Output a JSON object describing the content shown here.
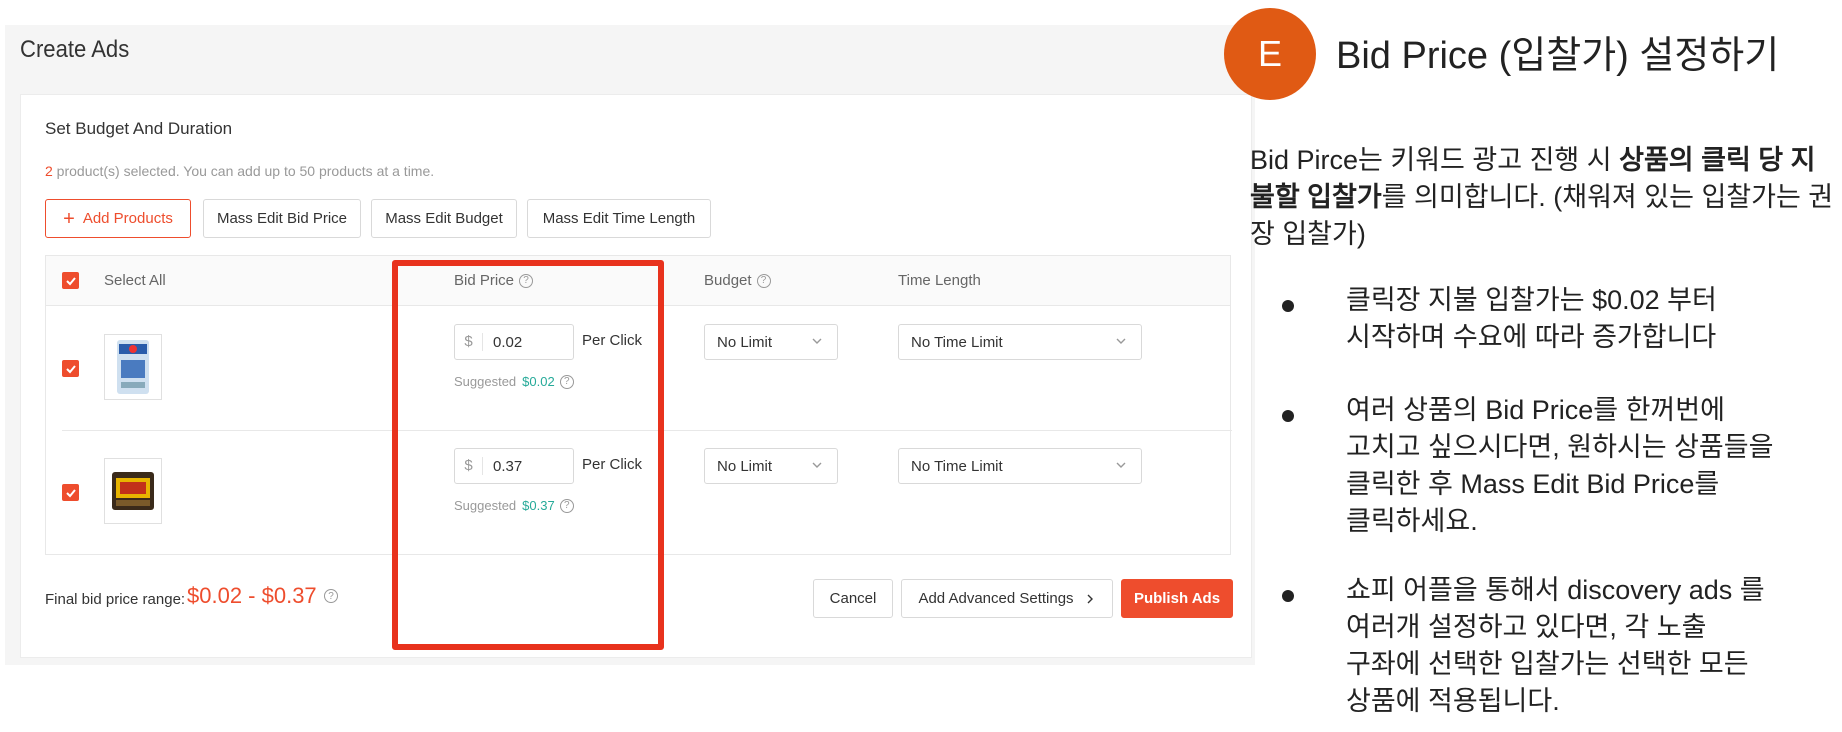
{
  "header": {
    "title": "Create Ads"
  },
  "card": {
    "title": "Set Budget And Duration",
    "selected_count": "2",
    "selected_text": " product(s) selected. You can add up to 50 products at a time."
  },
  "toolbar": {
    "add_products": "Add Products",
    "mass_edit_bid": "Mass Edit Bid Price",
    "mass_edit_budget": "Mass Edit Budget",
    "mass_edit_time": "Mass Edit Time Length"
  },
  "table": {
    "headers": {
      "select_all": "Select All",
      "bid_price": "Bid Price",
      "budget": "Budget",
      "time_length": "Time Length"
    },
    "rows": [
      {
        "currency": "$",
        "bid": "0.02",
        "per_click": "Per Click",
        "suggested_label": "Suggested",
        "suggested_value": "$0.02",
        "budget": "No Limit",
        "time": "No Time Limit"
      },
      {
        "currency": "$",
        "bid": "0.37",
        "per_click": "Per Click",
        "suggested_label": "Suggested",
        "suggested_value": "$0.37",
        "budget": "No Limit",
        "time": "No Time Limit"
      }
    ]
  },
  "footer": {
    "range_label": "Final bid price range:",
    "range_value": "$0.02 - $0.37",
    "cancel": "Cancel",
    "advanced": "Add Advanced Settings",
    "publish": "Publish Ads"
  },
  "explain": {
    "badge": "E",
    "title": "Bid Price (입찰가) 설정하기",
    "intro_1": "Bid Pirce는 키워드 광고 진행 시 ",
    "intro_bold": "상품의 클릭 당 지불할 입찰가",
    "intro_2": "를 의미합니다. (채워져 있는 입찰가는 권장 입찰가)",
    "bullet_1_l1": "클릭장 지불 입찰가는 $0.02 부터",
    "bullet_1_l2": "시작하며 수요에 따라 증가합니다",
    "bullet_2_l1": "여러 상품의 Bid Price를 한꺼번에",
    "bullet_2_l2": "고치고 싶으시다면, 원하시는 상품들을",
    "bullet_2_l3": "클릭한 후 Mass Edit Bid Price를",
    "bullet_2_l4": "클릭하세요.",
    "bullet_3_l1": "쇼피 어플을 통해서 discovery ads 를",
    "bullet_3_l2": "여러개 설정하고 있다면, 각 노출",
    "bullet_3_l3": "구좌에 선택한 입찰가는 선택한 모든",
    "bullet_3_l4": "상품에 적용됩니다."
  },
  "colors": {
    "accent": "#ee4d2d",
    "highlight": "#e8321d",
    "badge": "#e05a14",
    "suggested": "#26aa99"
  }
}
